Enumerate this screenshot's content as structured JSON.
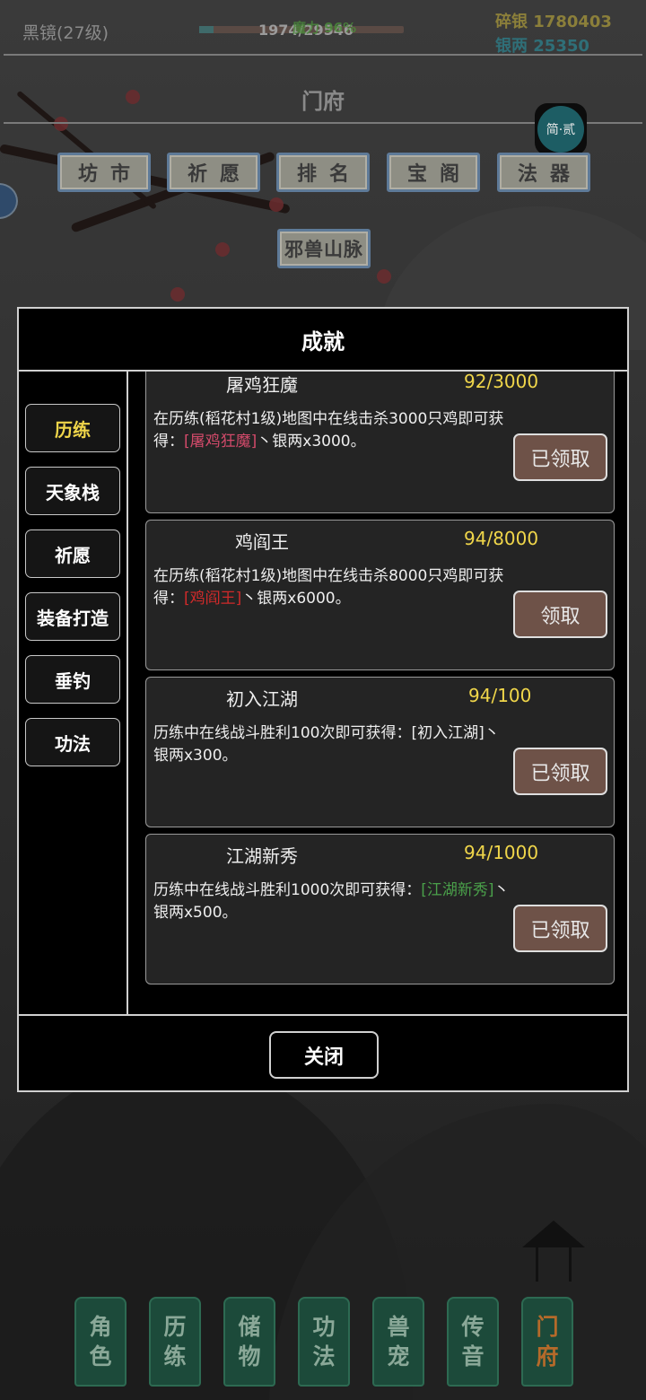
{
  "status": {
    "player_name": "黑镜(27级)",
    "hp_text": "1974/29546",
    "hp_pct_text": "魔力 96%",
    "hp_fraction": 0.07,
    "silver_fragments": "碎银 1780403",
    "silver_taels": "银两 25350"
  },
  "section": {
    "title": "门府",
    "jian_label": "简·贰"
  },
  "nav_buttons": [
    "坊市",
    "祈愿",
    "排名",
    "宝阁",
    "法器"
  ],
  "extra_button": "邪兽山脉",
  "modal": {
    "title": "成就",
    "tabs": [
      "历练",
      "天象栈",
      "祈愿",
      "装备打造",
      "垂钓",
      "功法"
    ],
    "active_tab": 0,
    "cards": [
      {
        "name": "屠鸡狂魔",
        "progress": "92/3000",
        "desc_a": "在历练(稻花村1级)地图中在线击杀3000只鸡即可获得：",
        "desc_hl": "[屠鸡狂魔]",
        "desc_b": "丶银两x3000。",
        "button": "已领取"
      },
      {
        "name": "鸡阎王",
        "progress": "94/8000",
        "desc_a": "在历练(稻花村1级)地图中在线击杀8000只鸡即可获得：",
        "desc_hl": "[鸡阎王]",
        "desc_b": "丶银两x6000。",
        "button": "领取"
      },
      {
        "name": "初入江湖",
        "progress": "94/100",
        "desc_a": "历练中在线战斗胜利100次即可获得：",
        "desc_hl": "[初入江湖]",
        "desc_b": "丶银两x300。",
        "button": "已领取"
      },
      {
        "name": "江湖新秀",
        "progress": "94/1000",
        "desc_a": "历练中在线战斗胜利1000次即可获得：",
        "desc_hl": "[江湖新秀]",
        "desc_b": "丶银两x500。",
        "button": "已领取"
      }
    ],
    "close_label": "关闭"
  },
  "bottom_nav": [
    {
      "top": "角",
      "bottom": "色"
    },
    {
      "top": "历",
      "bottom": "练"
    },
    {
      "top": "储",
      "bottom": "物"
    },
    {
      "top": "功",
      "bottom": "法"
    },
    {
      "top": "兽",
      "bottom": "宠"
    },
    {
      "top": "传",
      "bottom": "音"
    },
    {
      "top": "门",
      "bottom": "府"
    }
  ],
  "colors": {
    "accent_gold": "#f0d64a",
    "claim_button": "#6e5248",
    "nav_green": "#1c4a3a"
  }
}
